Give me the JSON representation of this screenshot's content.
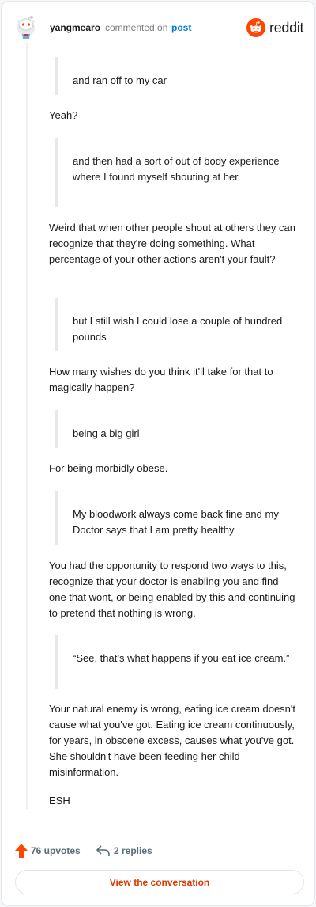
{
  "header": {
    "username": "yangmearo",
    "commented_on": "commented on",
    "post_link": "post",
    "brand": "reddit",
    "brand_color": "#ff4500"
  },
  "comment": {
    "blocks": [
      {
        "type": "quote",
        "text": "and ran off to my car"
      },
      {
        "type": "para",
        "text": "Yeah?"
      },
      {
        "type": "quote",
        "text": "and then had a sort of out of body experience where I found myself shouting at her."
      },
      {
        "type": "para",
        "text": "Weird that when other people shout at others they can recognize that they're doing something. What percentage of your other actions aren't your fault?"
      },
      {
        "type": "quote",
        "text": "but I still wish I could lose a couple of hundred pounds"
      },
      {
        "type": "para",
        "text": "How many wishes do you think it'll take for that to magically happen?"
      },
      {
        "type": "quote",
        "text": "being a big girl"
      },
      {
        "type": "para",
        "text": "For being morbidly obese."
      },
      {
        "type": "quote",
        "text": "My bloodwork always come back fine and my Doctor says that I am pretty healthy"
      },
      {
        "type": "para",
        "text": "You had the opportunity to respond two ways to this, recognize that your doctor is enabling you and find one that wont, or being enabled by this and continuing to pretend that nothing is wrong."
      },
      {
        "type": "quote",
        "text": "“See, that’s what happens if you eat ice cream.”"
      },
      {
        "type": "para",
        "text": "Your natural enemy is wrong, eating ice cream doesn't cause what you've got. Eating ice cream continuously, for years, in obscene excess, causes what you've got. She shouldn't have been feeding her child misinformation."
      },
      {
        "type": "para",
        "text": "ESH"
      }
    ]
  },
  "footer": {
    "upvotes": "76 upvotes",
    "upvote_icon": "arrow-up-icon",
    "upvote_color": "#ff4500",
    "replies": "2 replies",
    "reply_icon": "reply-arrow-icon",
    "view_conversation": "View the conversation",
    "cta_color": "#d93a00"
  }
}
